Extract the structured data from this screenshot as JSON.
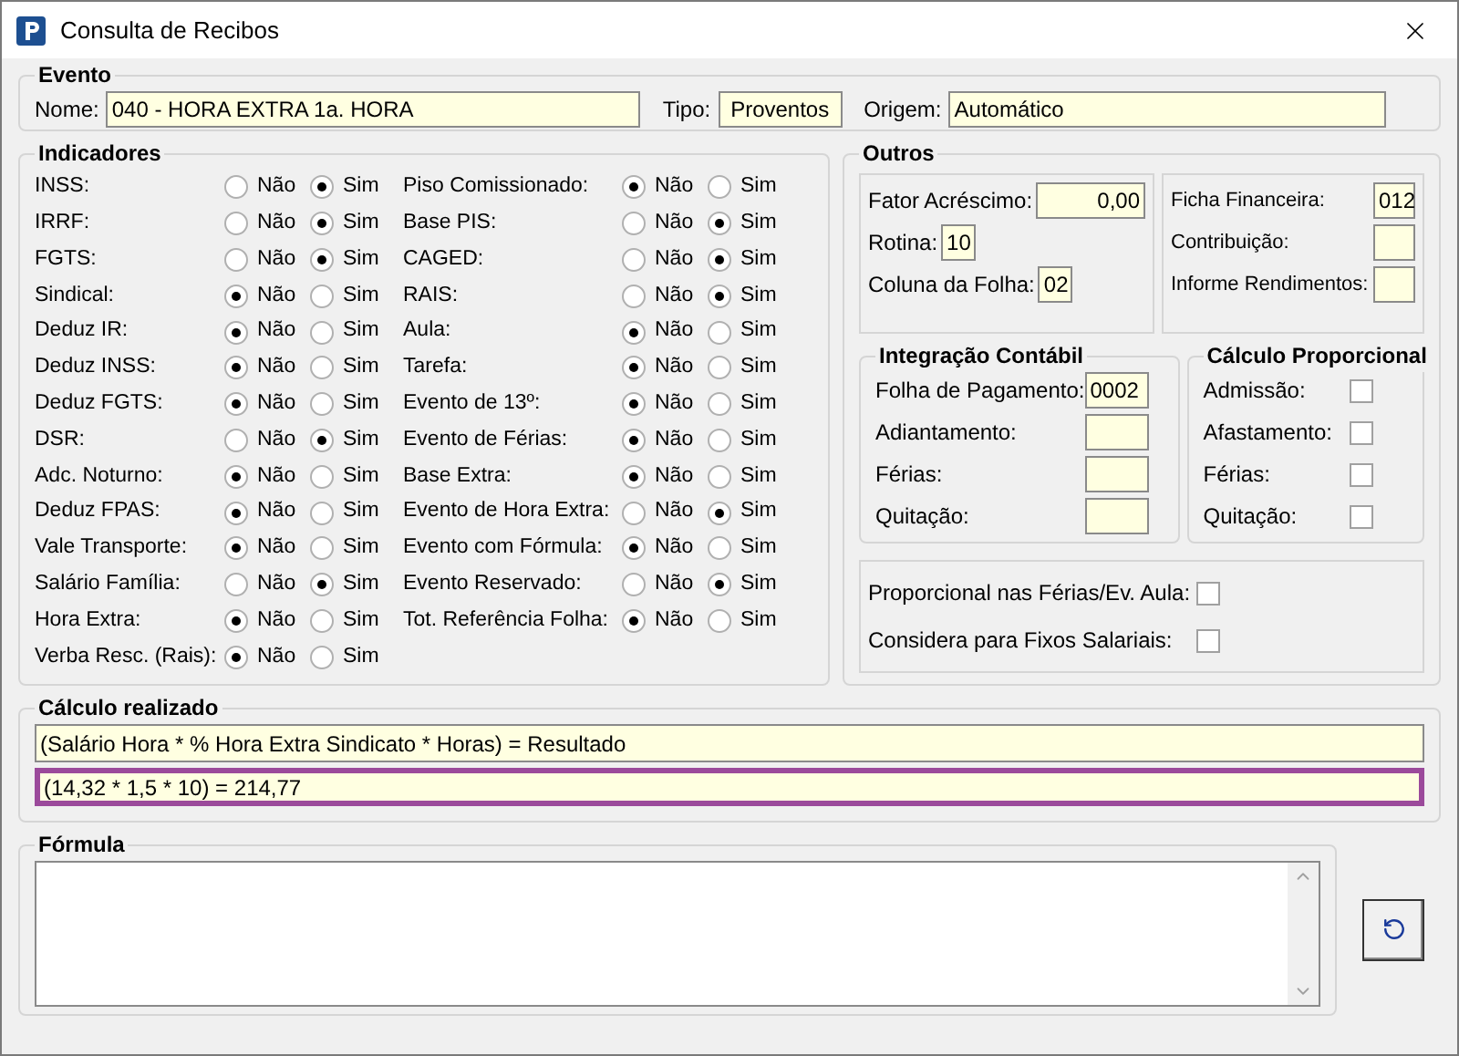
{
  "window": {
    "title": "Consulta de Recibos"
  },
  "evento": {
    "title": "Evento",
    "fields": [
      {
        "label": "Nome:",
        "value": "040 - HORA EXTRA 1a. HORA"
      },
      {
        "label": "Tipo:",
        "value": "Proventos"
      },
      {
        "label": "Origem:",
        "value": "Automático"
      }
    ]
  },
  "indicadores": {
    "title": "Indicadores",
    "columns": [
      [
        {
          "label": "INSS:",
          "options": [
            {
              "label": "Não",
              "selected": false
            },
            {
              "label": "Sim",
              "selected": true
            }
          ]
        },
        {
          "label": "IRRF:",
          "options": [
            {
              "label": "Não",
              "selected": false
            },
            {
              "label": "Sim",
              "selected": true
            }
          ]
        },
        {
          "label": "FGTS:",
          "options": [
            {
              "label": "Não",
              "selected": false
            },
            {
              "label": "Sim",
              "selected": true
            }
          ]
        },
        {
          "label": "Sindical:",
          "options": [
            {
              "label": "Não",
              "selected": true
            },
            {
              "label": "Sim",
              "selected": false
            }
          ]
        },
        {
          "label": "Deduz IR:",
          "options": [
            {
              "label": "Não",
              "selected": true
            },
            {
              "label": "Sim",
              "selected": false
            }
          ]
        },
        {
          "label": "Deduz INSS:",
          "options": [
            {
              "label": "Não",
              "selected": true
            },
            {
              "label": "Sim",
              "selected": false
            }
          ]
        },
        {
          "label": "Deduz FGTS:",
          "options": [
            {
              "label": "Não",
              "selected": true
            },
            {
              "label": "Sim",
              "selected": false
            }
          ]
        },
        {
          "label": "DSR:",
          "options": [
            {
              "label": "Não",
              "selected": false
            },
            {
              "label": "Sim",
              "selected": true
            }
          ]
        },
        {
          "label": "Adc. Noturno:",
          "options": [
            {
              "label": "Não",
              "selected": true
            },
            {
              "label": "Sim",
              "selected": false
            }
          ]
        },
        {
          "label": "Deduz FPAS:",
          "options": [
            {
              "label": "Não",
              "selected": true
            },
            {
              "label": "Sim",
              "selected": false
            }
          ]
        },
        {
          "label": "Vale Transporte:",
          "options": [
            {
              "label": "Não",
              "selected": true
            },
            {
              "label": "Sim",
              "selected": false
            }
          ]
        },
        {
          "label": "Salário Família:",
          "options": [
            {
              "label": "Não",
              "selected": false
            },
            {
              "label": "Sim",
              "selected": true
            }
          ]
        },
        {
          "label": "Hora Extra:",
          "options": [
            {
              "label": "Não",
              "selected": true
            },
            {
              "label": "Sim",
              "selected": false
            }
          ]
        },
        {
          "label": "Verba Resc. (Rais):",
          "options": [
            {
              "label": "Não",
              "selected": true
            },
            {
              "label": "Sim",
              "selected": false
            }
          ]
        }
      ],
      [
        {
          "label": "Piso Comissionado:",
          "options": [
            {
              "label": "Não",
              "selected": true
            },
            {
              "label": "Sim",
              "selected": false
            }
          ]
        },
        {
          "label": "Base PIS:",
          "options": [
            {
              "label": "Não",
              "selected": false
            },
            {
              "label": "Sim",
              "selected": true
            }
          ]
        },
        {
          "label": "CAGED:",
          "options": [
            {
              "label": "Não",
              "selected": false
            },
            {
              "label": "Sim",
              "selected": true
            }
          ]
        },
        {
          "label": "RAIS:",
          "options": [
            {
              "label": "Não",
              "selected": false
            },
            {
              "label": "Sim",
              "selected": true
            }
          ]
        },
        {
          "label": "Aula:",
          "options": [
            {
              "label": "Não",
              "selected": true
            },
            {
              "label": "Sim",
              "selected": false
            }
          ]
        },
        {
          "label": "Tarefa:",
          "options": [
            {
              "label": "Não",
              "selected": true
            },
            {
              "label": "Sim",
              "selected": false
            }
          ]
        },
        {
          "label": "Evento de 13º:",
          "options": [
            {
              "label": "Não",
              "selected": true
            },
            {
              "label": "Sim",
              "selected": false
            }
          ]
        },
        {
          "label": "Evento de Férias:",
          "options": [
            {
              "label": "Não",
              "selected": true
            },
            {
              "label": "Sim",
              "selected": false
            }
          ]
        },
        {
          "label": "Base Extra:",
          "options": [
            {
              "label": "Não",
              "selected": true
            },
            {
              "label": "Sim",
              "selected": false
            }
          ]
        },
        {
          "label": "Evento de Hora Extra:",
          "options": [
            {
              "label": "Não",
              "selected": false
            },
            {
              "label": "Sim",
              "selected": true
            }
          ]
        },
        {
          "label": "Evento com Fórmula:",
          "options": [
            {
              "label": "Não",
              "selected": true
            },
            {
              "label": "Sim",
              "selected": false
            }
          ]
        },
        {
          "label": "Evento Reservado:",
          "options": [
            {
              "label": "Não",
              "selected": false
            },
            {
              "label": "Sim",
              "selected": true
            }
          ]
        },
        {
          "label": "Tot. Referência Folha:",
          "options": [
            {
              "label": "Não",
              "selected": true
            },
            {
              "label": "Sim",
              "selected": false
            }
          ]
        }
      ]
    ]
  },
  "outros": {
    "title": "Outros",
    "box_1": [
      {
        "label": "Fator Acréscimo:",
        "value": "0,00"
      },
      {
        "label": "Rotina:",
        "value": "10"
      },
      {
        "label": "Coluna da Folha:",
        "value": "02"
      }
    ],
    "box_2": [
      {
        "label": "Ficha Financeira:",
        "value": "012"
      },
      {
        "label": "Contribuição:"
      },
      {
        "label": "Informe Rendimentos:"
      }
    ],
    "integracao": {
      "title": "Integração Contábil",
      "fields": [
        {
          "label": "Folha de Pagamento:",
          "value": "0002"
        },
        {
          "label": "Adiantamento:"
        },
        {
          "label": "Férias:"
        },
        {
          "label": "Quitação:"
        }
      ]
    },
    "proporcional": {
      "title": "Cálculo Proporcional",
      "items": [
        {
          "label": "Admissão:",
          "checked": false
        },
        {
          "label": "Afastamento:",
          "checked": false
        },
        {
          "label": "Férias:",
          "checked": false
        },
        {
          "label": "Quitação:",
          "checked": false
        }
      ]
    },
    "box_3": [
      {
        "label": "Proporcional nas Férias/Ev. Aula:",
        "checked": false
      },
      {
        "label": "Considera para Fixos Salariais:",
        "checked": false
      }
    ]
  },
  "calculo": {
    "title": "Cálculo realizado",
    "lines": [
      {
        "text": "(Salário Hora * % Hora Extra Sindicato * Horas) = Resultado",
        "selected": false
      },
      {
        "text": "(14,32 * 1,5 * 10) = 214,77",
        "selected": true
      }
    ]
  },
  "formula": {
    "title": "Fórmula"
  }
}
